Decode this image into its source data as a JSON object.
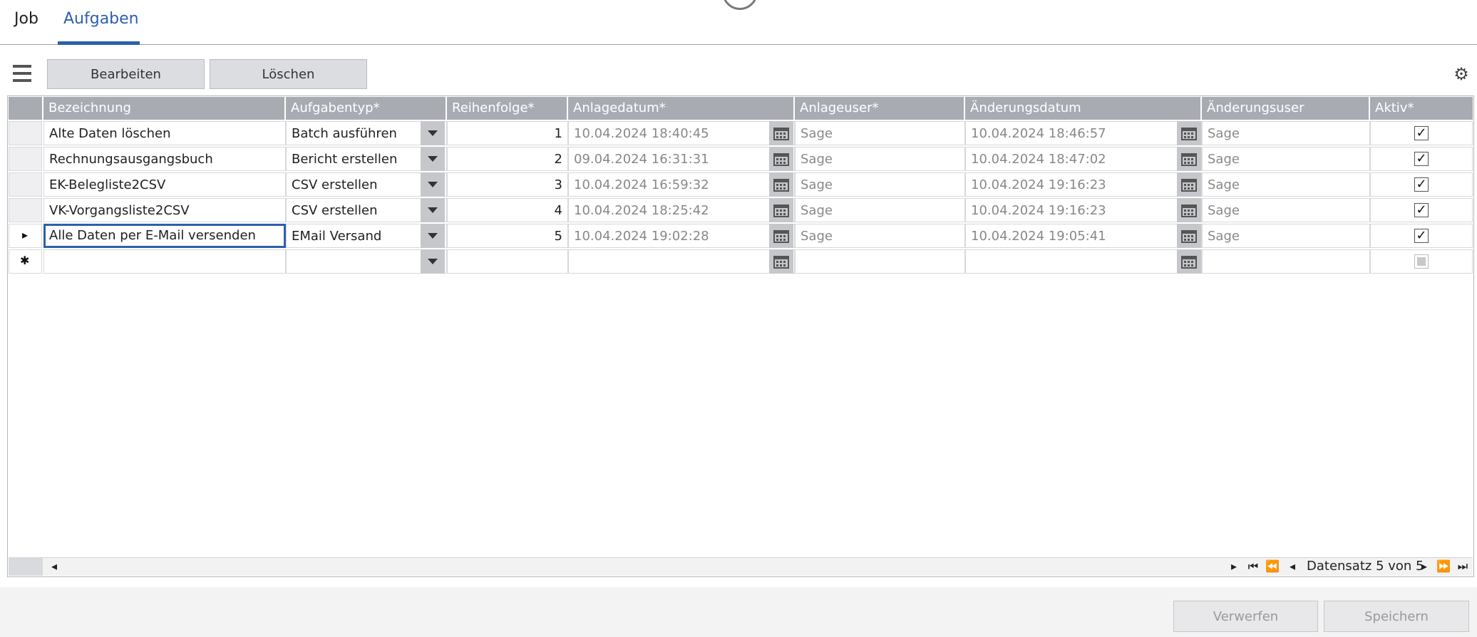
{
  "tabs": [
    {
      "label": "Job",
      "active": false
    },
    {
      "label": "Aufgaben",
      "active": true
    }
  ],
  "toolbar": {
    "menu_icon": "hamburger-icon",
    "edit_label": "Bearbeiten",
    "delete_label": "Löschen",
    "settings_icon": "gear-icon"
  },
  "grid": {
    "columns": [
      "Bezeichnung",
      "Aufgabentyp*",
      "Reihenfolge*",
      "Anlagedatum*",
      "Anlageuser*",
      "Änderungsdatum",
      "Änderungsuser",
      "Aktiv*"
    ],
    "rows": [
      {
        "bezeichnung": "Alte Daten löschen",
        "typ": "Batch ausführen",
        "reihenfolge": "1",
        "anlagedatum": "10.04.2024 18:40:45",
        "anlageuser": "Sage",
        "aenderungsdatum": "10.04.2024 18:46:57",
        "aenderungsuser": "Sage",
        "aktiv": true
      },
      {
        "bezeichnung": "Rechnungsausgangsbuch",
        "typ": "Bericht erstellen",
        "reihenfolge": "2",
        "anlagedatum": "09.04.2024 16:31:31",
        "anlageuser": "Sage",
        "aenderungsdatum": "10.04.2024 18:47:02",
        "aenderungsuser": "Sage",
        "aktiv": true
      },
      {
        "bezeichnung": "EK-Belegliste2CSV",
        "typ": "CSV erstellen",
        "reihenfolge": "3",
        "anlagedatum": "10.04.2024 16:59:32",
        "anlageuser": "Sage",
        "aenderungsdatum": "10.04.2024 19:16:23",
        "aenderungsuser": "Sage",
        "aktiv": true
      },
      {
        "bezeichnung": "VK-Vorgangsliste2CSV",
        "typ": "CSV erstellen",
        "reihenfolge": "4",
        "anlagedatum": "10.04.2024 18:25:42",
        "anlageuser": "Sage",
        "aenderungsdatum": "10.04.2024 19:16:23",
        "aenderungsuser": "Sage",
        "aktiv": true
      },
      {
        "bezeichnung": "Alle Daten per E-Mail versenden",
        "typ": "EMail Versand",
        "reihenfolge": "5",
        "anlagedatum": "10.04.2024 19:02:28",
        "anlageuser": "Sage",
        "aenderungsdatum": "10.04.2024 19:05:41",
        "aenderungsuser": "Sage",
        "aktiv": true
      }
    ],
    "current_row_marker": "▸",
    "new_row_marker": "✱"
  },
  "pager": {
    "status": "Datensatz 5 von 5"
  },
  "footer": {
    "discard_label": "Verwerfen",
    "save_label": "Speichern"
  }
}
